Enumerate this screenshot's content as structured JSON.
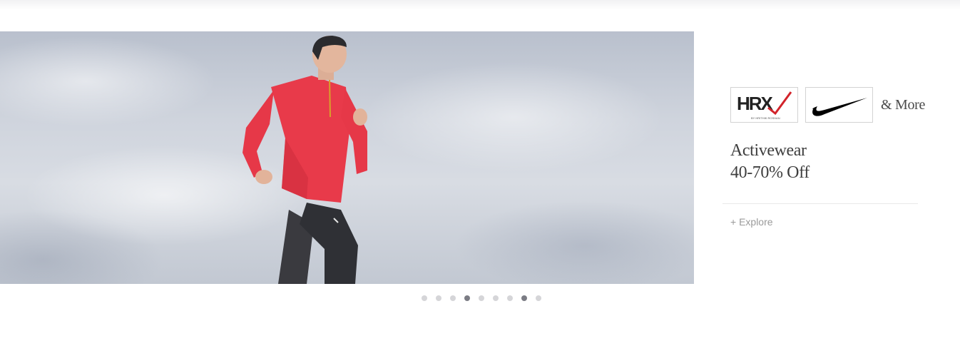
{
  "banner": {
    "image": "man-running-red-activewear",
    "brands": [
      {
        "name": "HRX",
        "icon": "hrx-logo",
        "tagline": "BY HRITHIK ROSHAN"
      },
      {
        "name": "Nike",
        "icon": "nike-swoosh-logo"
      }
    ],
    "more_label": "& More",
    "headline_line1": "Activewear",
    "headline_line2": "40-70% Off",
    "cta_label": "+ Explore"
  },
  "carousel": {
    "total": 9,
    "active": [
      4,
      8
    ]
  },
  "colors": {
    "jacket": "#e83a4a",
    "hrx_accent": "#d2232a",
    "dot_active": "#7b7c84",
    "dot_inactive": "#d5d5d8"
  }
}
